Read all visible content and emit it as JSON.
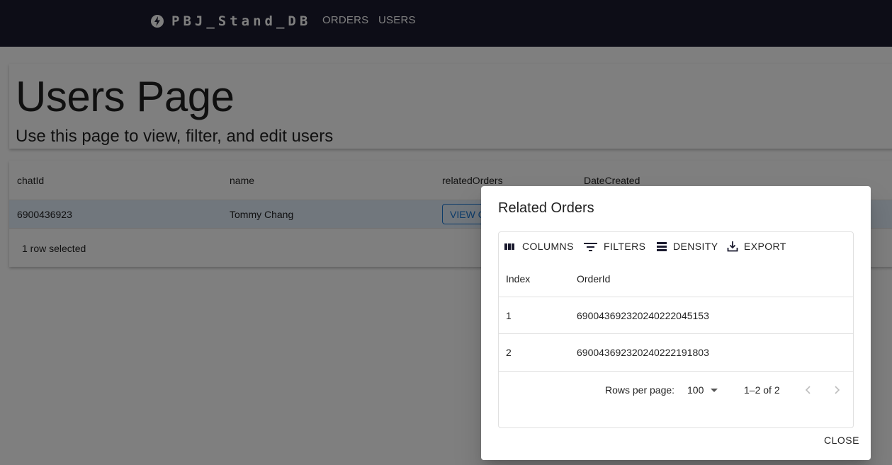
{
  "appbar": {
    "brand": "PBJ_Stand_DB",
    "nav": [
      "ORDERS",
      "USERS"
    ]
  },
  "header": {
    "title": "Users Page",
    "subtitle": "Use this page to view, filter, and edit users"
  },
  "users_grid": {
    "columns": [
      "chatId",
      "name",
      "relatedOrders",
      "DateCreated"
    ],
    "rows": [
      {
        "chatId": "6900436923",
        "name": "Tommy Chang",
        "relatedOrders_button": "VIEW C"
      }
    ],
    "selected_text": "1 row selected"
  },
  "dialog": {
    "title": "Related Orders",
    "toolbar": {
      "columns": "COLUMNS",
      "filters": "FILTERS",
      "density": "DENSITY",
      "export": "EXPORT"
    },
    "columns": [
      "Index",
      "OrderId"
    ],
    "rows": [
      {
        "index": "1",
        "orderId": "69004369232024022204​5153"
      },
      {
        "index": "2",
        "orderId": "690043692320240222191803"
      }
    ],
    "footer": {
      "rows_per_page_label": "Rows per page:",
      "rows_per_page_value": "100",
      "range": "1–2 of 2"
    },
    "close_label": "CLOSE"
  },
  "colors": {
    "appbar": "#1a1a2e",
    "primary": "#1976d2",
    "selected_row": "#e3eefa"
  }
}
